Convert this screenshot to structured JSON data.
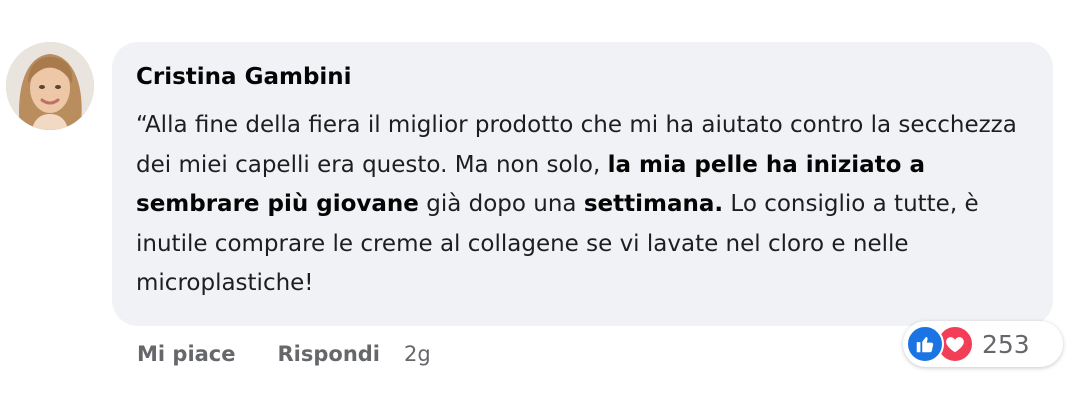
{
  "comment": {
    "author": "Cristina Gambini",
    "text": {
      "p1": "“Alla fine della fiera il miglior prodotto che mi ha aiutato contro la secchezza dei miei capelli era questo. Ma non solo, ",
      "b1": "la mia pelle ha iniziato a sembrare più giovane",
      "p2": " già dopo una ",
      "b2": "settimana.",
      "p3": " Lo consiglio a tutte, è inutile comprare le creme al collagene se vi lavate nel cloro e nelle microplastiche!"
    }
  },
  "actions": {
    "like_label": "Mi piace",
    "reply_label": "Rispondi",
    "timestamp": "2g"
  },
  "reactions": {
    "icons": [
      "like-icon",
      "love-icon"
    ],
    "count": "253",
    "colors": {
      "like": "#1b74e4",
      "love": "#f33e58"
    }
  }
}
